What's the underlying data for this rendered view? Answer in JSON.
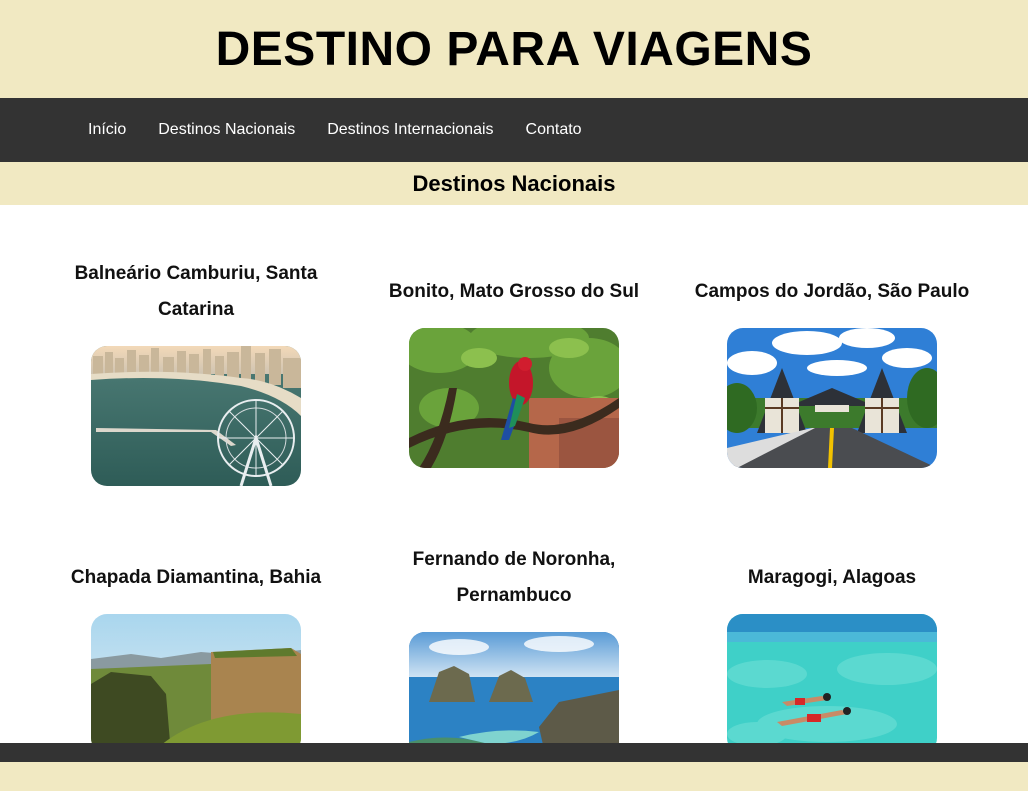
{
  "header": {
    "title": "DESTINO PARA VIAGENS"
  },
  "nav": {
    "items": [
      {
        "label": "Início"
      },
      {
        "label": "Destinos Nacionais"
      },
      {
        "label": "Destinos Internacionais"
      },
      {
        "label": "Contato"
      }
    ]
  },
  "section": {
    "title": "Destinos Nacionais"
  },
  "destinations": [
    {
      "name": "Balneário Camburiu, Santa Catarina",
      "image": "coastal-city-ferris-wheel-photo"
    },
    {
      "name": "Bonito, Mato Grosso do Sul",
      "image": "red-macaw-tree-photo"
    },
    {
      "name": "Campos do Jordão, São Paulo",
      "image": "alpine-gate-road-photo"
    },
    {
      "name": "Chapada Diamantina, Bahia",
      "image": "plateau-mountains-photo"
    },
    {
      "name": "Fernando de Noronha, Pernambuco",
      "image": "twin-rocks-sea-photo"
    },
    {
      "name": "Maragogi, Alagoas",
      "image": "turquoise-water-snorkel-photo"
    }
  ],
  "colors": {
    "cream": "#f1e9c2",
    "dark": "#333333"
  }
}
